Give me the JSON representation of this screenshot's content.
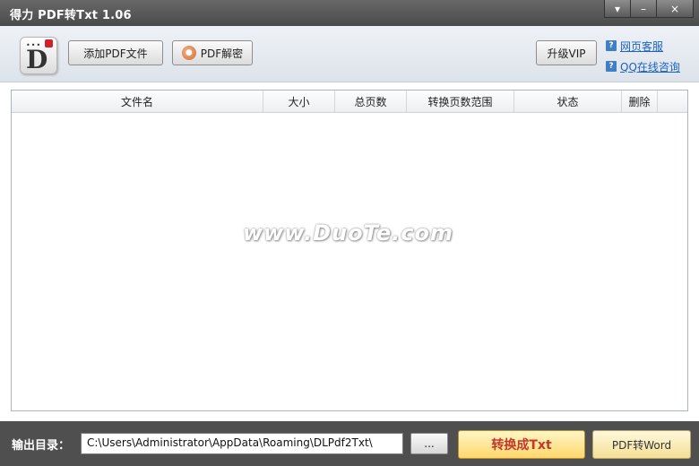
{
  "window": {
    "title": "得力 PDF转Txt 1.06",
    "controls": {
      "menu": "▾",
      "minimize": "–",
      "close": "×"
    }
  },
  "toolbar": {
    "logo_letter": "D",
    "add_pdf_label": "添加PDF文件",
    "decrypt_label": "PDF解密",
    "vip_label": "升级VIP",
    "links": [
      {
        "icon": "?",
        "label": "网页客服"
      },
      {
        "icon": "?",
        "label": "QQ在线咨询"
      }
    ]
  },
  "table": {
    "columns": [
      "文件名",
      "大小",
      "总页数",
      "转换页数范围",
      "状态",
      "删除"
    ],
    "rows": [],
    "watermark": "www.DuoTe.com"
  },
  "bottom": {
    "output_label": "输出目录：",
    "output_path": "C:\\Users\\Administrator\\AppData\\Roaming\\DLPdf2Txt\\",
    "browse_label": "...",
    "convert_label": "转换成Txt",
    "to_word_label": "PDF转Word"
  },
  "colors": {
    "titlebar": "#555555",
    "link": "#1a62c4",
    "convert_text": "#c0392b",
    "bottom_bar": "#4f4f4f"
  }
}
